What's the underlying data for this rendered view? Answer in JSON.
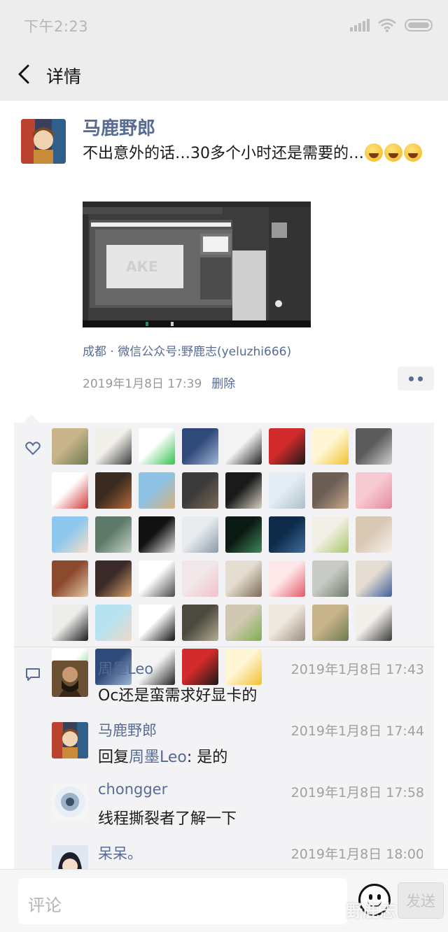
{
  "status_bar": {
    "time": "下午2:23"
  },
  "nav": {
    "title": "详情"
  },
  "post": {
    "author": "马鹿野郎",
    "text": "不出意外的话…30多个小时还是需要的…",
    "emoji_count": 3,
    "location": "成都 · 微信公众号:野鹿志(yeluzhi666)",
    "time": "2019年1月8日 17:39",
    "delete_label": "删除"
  },
  "likes": {
    "count": 45
  },
  "comments": [
    {
      "name": "周墨Leo",
      "time": "2019年1月8日 17:43",
      "text": "Oc还是蛮需求好显卡的"
    },
    {
      "name": "马鹿野郎",
      "time": "2019年1月8日 17:44",
      "reply_prefix": "回复",
      "reply_to": "周墨Leo",
      "text": ": 是的"
    },
    {
      "name": "chongger",
      "time": "2019年1月8日 17:58",
      "text": "线程撕裂者了解一下"
    },
    {
      "name": "呆呆。",
      "time": "2019年1月8日 18:00",
      "text": ""
    }
  ],
  "input": {
    "placeholder": "评论",
    "send_label": "发送"
  },
  "watermark": "野鹿志",
  "colors": {
    "link": "#576b95",
    "panel": "#f3f3f5",
    "bar": "#ededed"
  }
}
